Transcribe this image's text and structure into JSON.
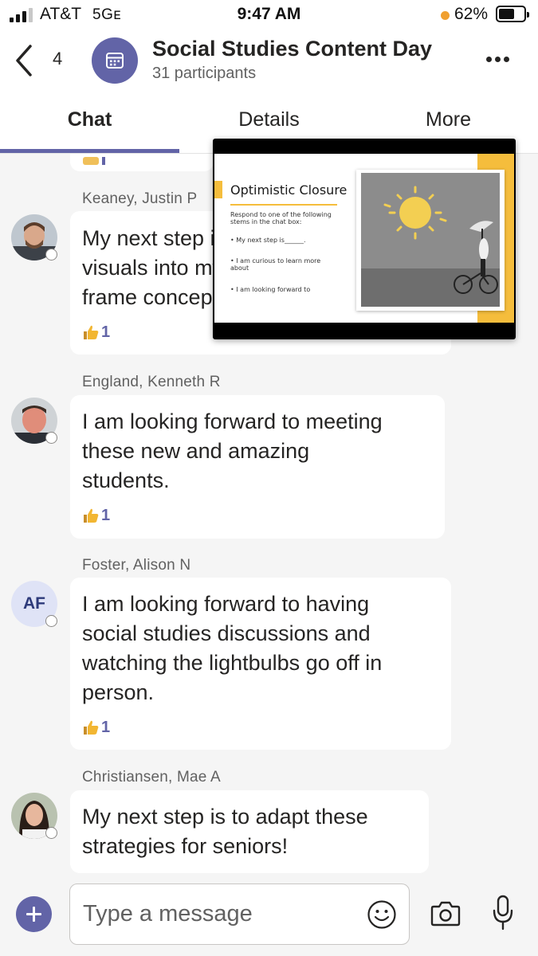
{
  "status_bar": {
    "carrier": "AT&T",
    "network": "5Gᴇ",
    "time": "9:47 AM",
    "battery_percent": "62%",
    "battery_level": 0.62,
    "signal_bars": 3,
    "low_power_dot_color": "#f0a030"
  },
  "header": {
    "back_count": "4",
    "title": "Social Studies Content Day",
    "subtitle": "31 participants",
    "group_icon": "calendar-icon",
    "accent_color": "#6264a7"
  },
  "tabs": [
    {
      "label": "Chat",
      "active": true
    },
    {
      "label": "Details",
      "active": false
    },
    {
      "label": "More",
      "active": false
    }
  ],
  "slide_preview": {
    "title": "Optimistic Closure",
    "prompt": "Respond to one of the following stems in the chat box:",
    "bullets": [
      "My next step is______.",
      "I am curious to learn more about",
      "I am looking forward to"
    ]
  },
  "messages": [
    {
      "sender": "Keaney, Justin P",
      "lines": [
        "My next step is to incorporate more",
        "visuals into my lessons and use the",
        "frame concept."
      ],
      "reaction_icon": "thumbs-up-icon",
      "reaction_count": "1"
    },
    {
      "sender": "England, Kenneth R",
      "lines": [
        "I am looking forward to meeting",
        "these new and amazing",
        "students."
      ],
      "reaction_icon": "thumbs-up-icon",
      "reaction_count": "1"
    },
    {
      "sender": "Foster, Alison N",
      "initials": "AF",
      "lines": [
        "I am looking forward to having",
        "social studies discussions and",
        "watching the lightbulbs go off in",
        "person."
      ],
      "reaction_icon": "thumbs-up-icon",
      "reaction_count": "1"
    },
    {
      "sender": "Christiansen, Mae A",
      "lines": [
        "My next step is to adapt these",
        "strategies for seniors!"
      ]
    }
  ],
  "composer": {
    "placeholder": "Type a message",
    "icons": [
      "plus-icon",
      "emoji-icon",
      "camera-icon",
      "microphone-icon"
    ]
  }
}
